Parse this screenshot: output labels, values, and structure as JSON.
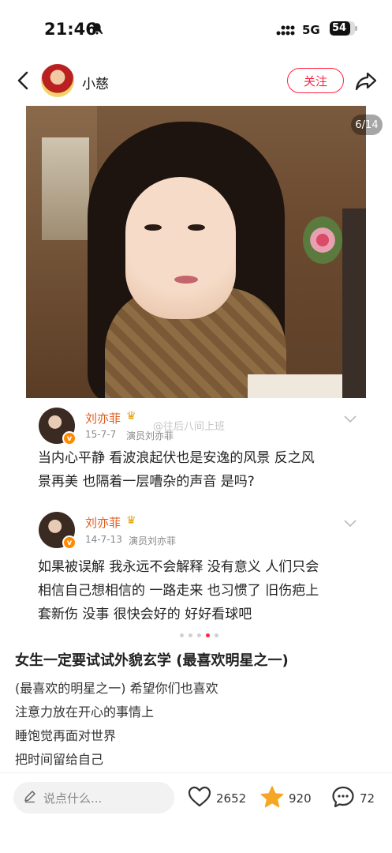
{
  "status": {
    "time": "21:46",
    "network": "5G",
    "battery": "54"
  },
  "header": {
    "author": "小慈",
    "follow_label": "关注"
  },
  "photo": {
    "page_indicator": "6/14"
  },
  "cards": [
    {
      "name": "刘亦菲",
      "date": "15-7-7",
      "verified": "演员刘亦菲",
      "lines": [
        "当内心平静 看波浪起伏也是安逸的风景 反之风",
        "景再美 也隔着一层嘈杂的声音 是吗?"
      ]
    },
    {
      "name": "刘亦菲",
      "date": "14-7-13",
      "verified": "演员刘亦菲",
      "lines": [
        "如果被误解 我永远不会解释 没有意义 人们只会",
        "相信自己想相信的 一路走来 也习惯了 旧伤疤上",
        "套新伤 没事 很快会好的 好好看球吧"
      ]
    }
  ],
  "watermark": "@往后八间上班",
  "carousel": {
    "total_dots": 5,
    "active_dot": 4
  },
  "post": {
    "title": "女生一定要试试外貌玄学 (最喜欢明星之一)",
    "lines": [
      "(最喜欢的明星之一) 希望你们也喜欢",
      "注意力放在开心的事情上",
      "睡饱觉再面对世界",
      "把时间留给自己"
    ]
  },
  "bottom": {
    "comment_placeholder": "说点什么...",
    "likes": "2652",
    "favorites": "920",
    "comments": "72"
  },
  "colors": {
    "accent": "#ff2442",
    "verified_name": "#e05a1a",
    "star": "#f5a623"
  }
}
